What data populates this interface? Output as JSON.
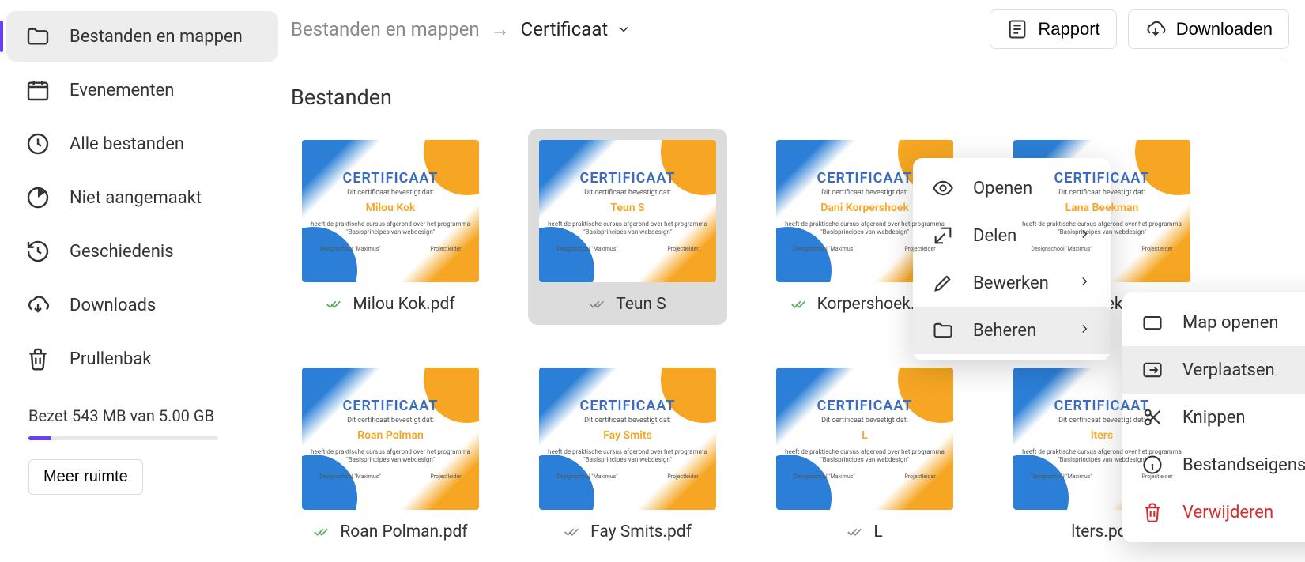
{
  "sidebar": {
    "items": [
      {
        "label": "Bestanden en mappen",
        "icon": "folder"
      },
      {
        "label": "Evenementen",
        "icon": "calendar"
      },
      {
        "label": "Alle bestanden",
        "icon": "clock"
      },
      {
        "label": "Niet aangemaakt",
        "icon": "pie"
      },
      {
        "label": "Geschiedenis",
        "icon": "history"
      },
      {
        "label": "Downloads",
        "icon": "download-cloud"
      },
      {
        "label": "Prullenbak",
        "icon": "trash"
      }
    ],
    "storage_text": "Bezet 543 MB van 5.00 GB",
    "more_space": "Meer ruimte"
  },
  "breadcrumb": {
    "root": "Bestanden en mappen",
    "current": "Certificaat"
  },
  "actions": {
    "report": "Rapport",
    "download": "Downloaden"
  },
  "section_title": "Bestanden",
  "thumb": {
    "title": "CERTIFICAAT",
    "sub": "Dit certificaat bevestigt dat:",
    "desc1": "heeft de praktische cursus afgerond over het programma",
    "desc2": "\"Basisprincipes van webdesign\"",
    "foot_left": "Designschool \"Maximus\"",
    "foot_right": "Projectleider"
  },
  "files": [
    {
      "person": "Milou Kok",
      "filename": "Milou Kok.pdf",
      "status": "done"
    },
    {
      "person": "Teun S",
      "filename": "Teun S",
      "status": "done-alt"
    },
    {
      "person": "Dani Korpershoek",
      "filename": "Korpershoek.pdf",
      "status": "done"
    },
    {
      "person": "Lana Beekman",
      "filename": "Lana Beekman.pdf",
      "status": "error"
    },
    {
      "person": "Roan Polman",
      "filename": "Roan Polman.pdf",
      "status": "done"
    },
    {
      "person": "Fay Smits",
      "filename": "Fay Smits.pdf",
      "status": "done-alt"
    },
    {
      "person": "L",
      "filename": "L",
      "status": "done-alt"
    },
    {
      "person": "lters",
      "filename": "lters.pdf",
      "status": ""
    }
  ],
  "ctx1": [
    {
      "label": "Openen",
      "icon": "eye",
      "arrow": false
    },
    {
      "label": "Delen",
      "icon": "share",
      "arrow": true
    },
    {
      "label": "Bewerken",
      "icon": "pencil",
      "arrow": true
    },
    {
      "label": "Beheren",
      "icon": "folder",
      "arrow": true,
      "hover": true
    }
  ],
  "ctx2": [
    {
      "label": "Map openen",
      "icon": "folder-outline"
    },
    {
      "label": "Verplaatsen",
      "icon": "move",
      "hover": true
    },
    {
      "label": "Knippen",
      "icon": "cut"
    },
    {
      "label": "Bestandseigenschappen",
      "icon": "info"
    },
    {
      "label": "Verwijderen",
      "icon": "trash",
      "danger": true
    }
  ]
}
